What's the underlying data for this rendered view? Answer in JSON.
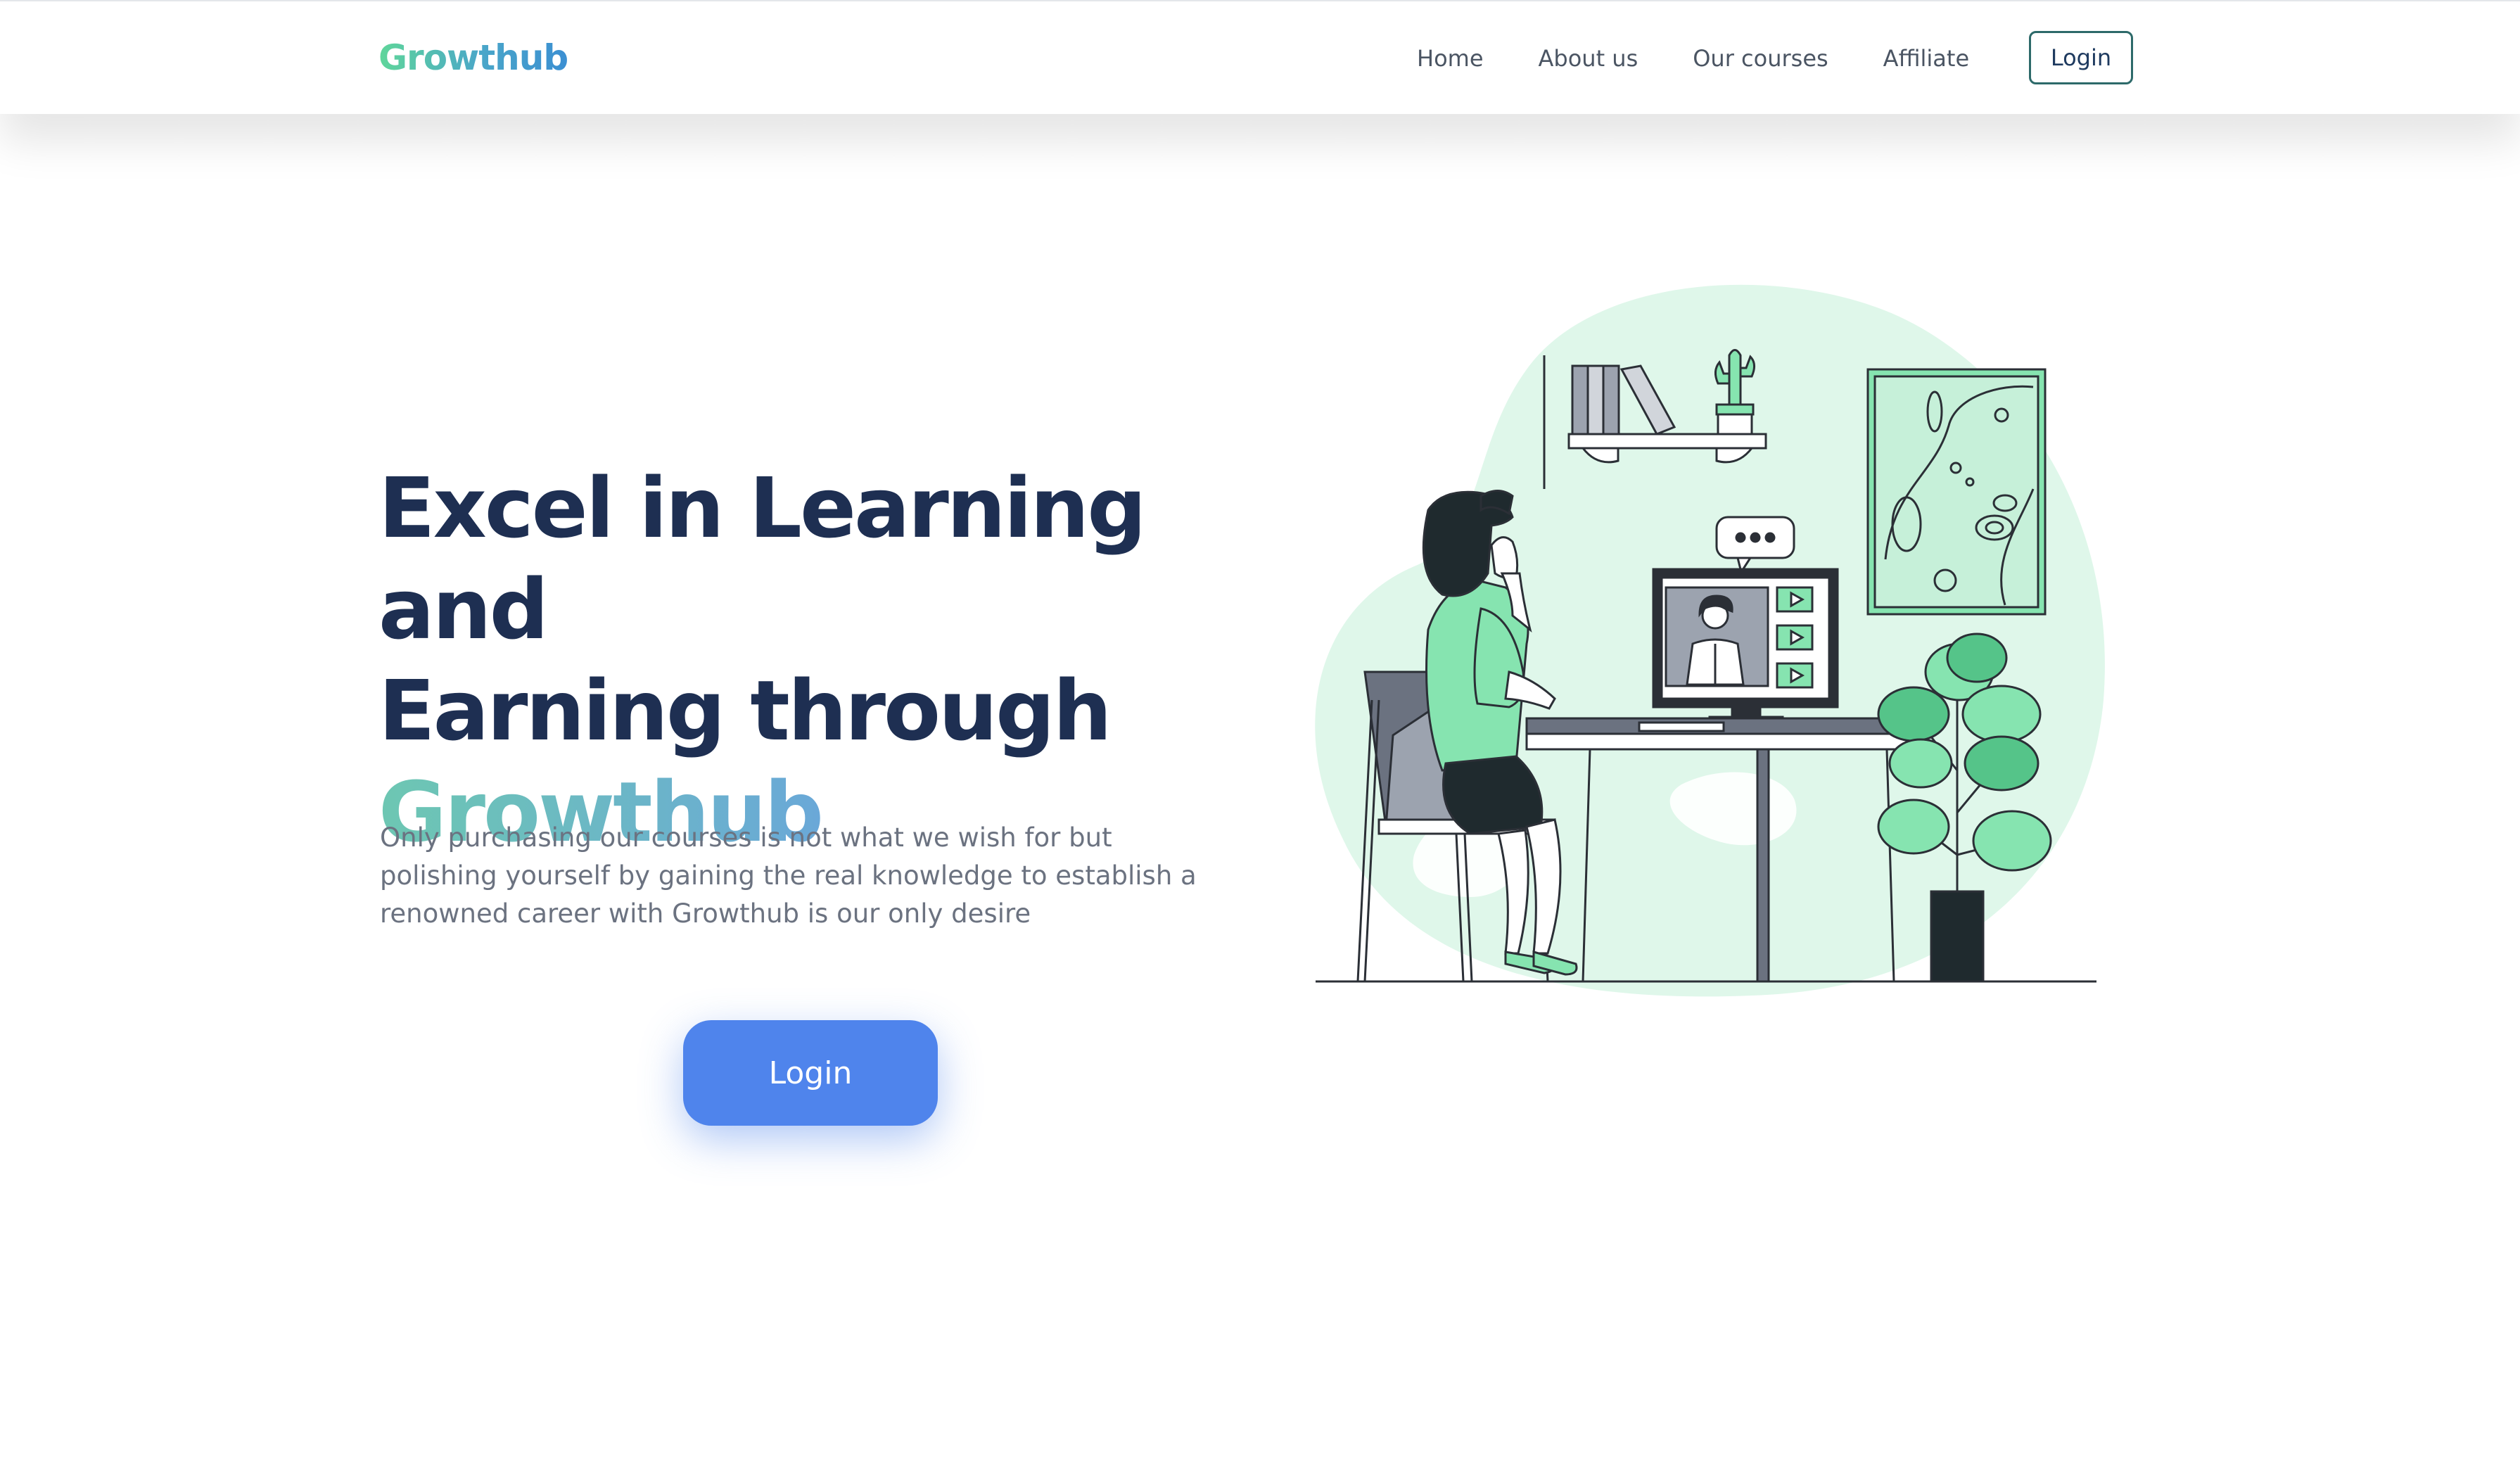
{
  "header": {
    "logo_text": "Growthub",
    "nav": [
      {
        "label": "Home"
      },
      {
        "label": "About us"
      },
      {
        "label": "Our courses"
      },
      {
        "label": "Affiliate"
      }
    ],
    "login_label": "Login"
  },
  "hero": {
    "title_line1": "Excel in Learning and",
    "title_line2": "Earning through",
    "title_brand": "Growthub",
    "description": "Only purchasing our courses is not what we wish for but polishing yourself by gaining the real knowledge to establish a renowned career with Growthub is our only desire",
    "login_label": "Login"
  },
  "colors": {
    "accent_blue": "#4f84ec",
    "navy_text": "#1e2f52",
    "mint": "#86e4b0",
    "blob": "#dff7ea"
  },
  "illustration": {
    "icon": "woman-studying-online-illustration"
  }
}
